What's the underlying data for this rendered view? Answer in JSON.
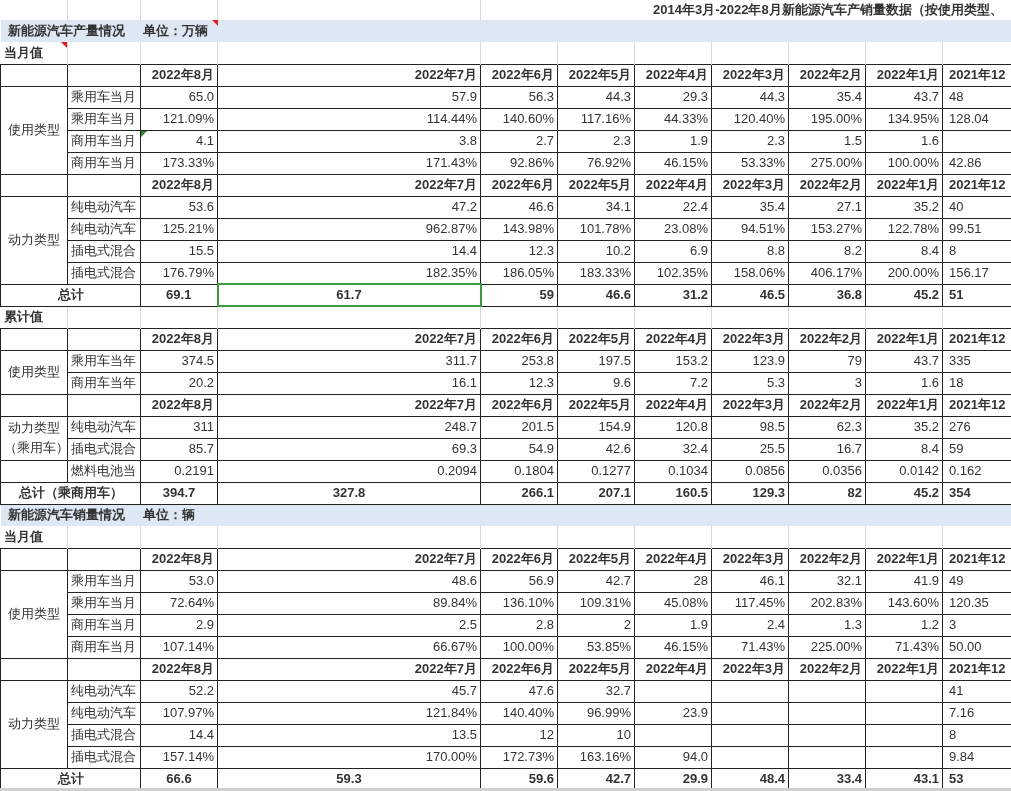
{
  "title": "2014年3月-2022年8月新能源汽车产销量数据（按使用类型、",
  "sections": [
    {
      "kind": "band",
      "title": "新能源汽车产量情况",
      "unit": "单位：万辆",
      "note": true
    },
    {
      "kind": "label",
      "text": "当月值",
      "note": true
    },
    {
      "kind": "block",
      "header": [
        "2022年8月",
        "2022年7月",
        "2022年6月",
        "2022年5月",
        "2022年4月",
        "2022年3月",
        "2022年2月",
        "2022年1月",
        "2021年12"
      ],
      "groups": [
        {
          "label": "使用类型",
          "rows": [
            {
              "label": "乘用车当月",
              "cells": [
                "65.0",
                "57.9",
                "56.3",
                "44.3",
                "29.3",
                "44.3",
                "35.4",
                "43.7",
                "48"
              ]
            },
            {
              "label": "乘用车当月",
              "cells": [
                "121.09%",
                "114.44%",
                "140.60%",
                "117.16%",
                "44.33%",
                "120.40%",
                "195.00%",
                "134.95%",
                "128.04"
              ]
            },
            {
              "label": "商用车当月",
              "warning": true,
              "cells": [
                "4.1",
                "3.8",
                "2.7",
                "2.3",
                "1.9",
                "2.3",
                "1.5",
                "1.6",
                null
              ]
            },
            {
              "label": "商用车当月",
              "cells": [
                "173.33%",
                "171.43%",
                "92.86%",
                "76.92%",
                "46.15%",
                "53.33%",
                "275.00%",
                "100.00%",
                "42.86"
              ]
            }
          ]
        }
      ]
    },
    {
      "kind": "block",
      "header": [
        "2022年8月",
        "2022年7月",
        "2022年6月",
        "2022年5月",
        "2022年4月",
        "2022年3月",
        "2022年2月",
        "2022年1月",
        "2021年12"
      ],
      "groups": [
        {
          "label": "动力类型",
          "rows": [
            {
              "label": "纯电动汽车",
              "cells": [
                "53.6",
                "47.2",
                "46.6",
                "34.1",
                "22.4",
                "35.4",
                "27.1",
                "35.2",
                "40"
              ]
            },
            {
              "label": "纯电动汽车",
              "cells": [
                "125.21%",
                "962.87%",
                "143.98%",
                "101.78%",
                "23.08%",
                "94.51%",
                "153.27%",
                "122.78%",
                "99.51"
              ]
            },
            {
              "label": "插电式混合",
              "cells": [
                "15.5",
                "14.4",
                "12.3",
                "10.2",
                "6.9",
                "8.8",
                "8.2",
                "8.4",
                "8"
              ]
            },
            {
              "label": "插电式混合",
              "cells": [
                "176.79%",
                "182.35%",
                "186.05%",
                "183.33%",
                "102.35%",
                "158.06%",
                "406.17%",
                "200.00%",
                "156.17"
              ]
            }
          ]
        }
      ]
    },
    {
      "kind": "total",
      "label": "总计",
      "cells": [
        {
          "value": "69.1",
          "selected": false
        },
        {
          "value": "61.7",
          "selected": true
        },
        {
          "value": "59",
          "selected": false
        },
        {
          "value": "46.6",
          "selected": false
        },
        {
          "value": "31.2",
          "selected": false
        },
        {
          "value": "46.5",
          "selected": false
        },
        {
          "value": "36.8",
          "selected": false
        },
        {
          "value": "45.2",
          "selected": false
        },
        {
          "value": "51",
          "selected": false
        }
      ]
    },
    {
      "kind": "label",
      "text": "累计值",
      "note": false
    },
    {
      "kind": "block",
      "header": [
        "2022年8月",
        "2022年7月",
        "2022年6月",
        "2022年5月",
        "2022年4月",
        "2022年3月",
        "2022年2月",
        "2022年1月",
        "2021年12"
      ],
      "groups": [
        {
          "label": "使用类型",
          "rows": [
            {
              "label": "乘用车当年",
              "cells": [
                "374.5",
                "311.7",
                "253.8",
                "197.5",
                "153.2",
                "123.9",
                "79",
                "43.7",
                "335"
              ]
            },
            {
              "label": "商用车当年",
              "cells": [
                "20.2",
                "16.1",
                "12.3",
                "9.6",
                "7.2",
                "5.3",
                "3",
                "1.6",
                "18"
              ]
            }
          ]
        }
      ]
    },
    {
      "kind": "block",
      "header": [
        "2022年8月",
        "2022年7月",
        "2022年6月",
        "2022年5月",
        "2022年4月",
        "2022年3月",
        "2022年2月",
        "2022年1月",
        "2021年12"
      ],
      "groups": [
        {
          "label": "动力类型",
          "label_2": "（乘用车）",
          "rows": [
            {
              "label": "纯电动汽车",
              "cells": [
                "311",
                "248.7",
                "201.5",
                "154.9",
                "120.8",
                "98.5",
                "62.3",
                "35.2",
                "276"
              ]
            },
            {
              "label": "插电式混合",
              "cells": [
                "85.7",
                "69.3",
                "54.9",
                "42.6",
                "32.4",
                "25.5",
                "16.7",
                "8.4",
                "59"
              ]
            }
          ]
        },
        {
          "rows": [
            {
              "label": "燃料电池当",
              "cells": [
                "0.2191",
                "0.2094",
                "0.1804",
                "0.1277",
                "0.1034",
                "0.0856",
                "0.0356",
                "0.0142",
                "0.162"
              ]
            }
          ]
        }
      ]
    },
    {
      "kind": "total",
      "label": "总计（乘商用车）",
      "cells": [
        {
          "value": "394.7",
          "selected": false
        },
        {
          "value": "327.8",
          "selected": false
        },
        {
          "value": "266.1",
          "selected": false
        },
        {
          "value": "207.1",
          "selected": false
        },
        {
          "value": "160.5",
          "selected": false
        },
        {
          "value": "129.3",
          "selected": false
        },
        {
          "value": "82",
          "selected": false
        },
        {
          "value": "45.2",
          "selected": false
        },
        {
          "value": "354",
          "selected": false
        }
      ]
    },
    {
      "kind": "band",
      "title": "新能源汽车销量情况",
      "unit": "单位：辆",
      "note": false
    },
    {
      "kind": "label",
      "text": "当月值",
      "note": false
    },
    {
      "kind": "block",
      "header": [
        "2022年8月",
        "2022年7月",
        "2022年6月",
        "2022年5月",
        "2022年4月",
        "2022年3月",
        "2022年2月",
        "2022年1月",
        "2021年12"
      ],
      "groups": [
        {
          "label": "使用类型",
          "rows": [
            {
              "label": "乘用车当月",
              "cells": [
                "53.0",
                "48.6",
                "56.9",
                "42.7",
                "28",
                "46.1",
                "32.1",
                "41.9",
                "49"
              ]
            },
            {
              "label": "乘用车当月",
              "cells": [
                "72.64%",
                "89.84%",
                "136.10%",
                "109.31%",
                "45.08%",
                "117.45%",
                "202.83%",
                "143.60%",
                "120.35"
              ]
            },
            {
              "label": "商用车当月",
              "cells": [
                "2.9",
                "2.5",
                "2.8",
                "2",
                "1.9",
                "2.4",
                "1.3",
                "1.2",
                "3"
              ]
            },
            {
              "label": "商用车当月",
              "cells": [
                "107.14%",
                "66.67%",
                "100.00%",
                "53.85%",
                "46.15%",
                "71.43%",
                "225.00%",
                "71.43%",
                "50.00"
              ]
            }
          ]
        }
      ]
    },
    {
      "kind": "block",
      "header": [
        "2022年8月",
        "2022年7月",
        "2022年6月",
        "2022年5月",
        "2022年4月",
        "2022年3月",
        "2022年2月",
        "2022年1月",
        "2021年12"
      ],
      "groups": [
        {
          "label": "动力类型",
          "rows": [
            {
              "label": "纯电动汽车",
              "cells": [
                "52.2",
                "45.7",
                "47.6",
                "32.7",
                null,
                null,
                null,
                null,
                "41"
              ]
            },
            {
              "label": "纯电动汽车",
              "cells": [
                "107.97%",
                "121.84%",
                "140.40%",
                "96.99%",
                "23.9",
                null,
                null,
                null,
                "7.16"
              ]
            },
            {
              "label": "插电式混合",
              "cells": [
                "14.4",
                "13.5",
                "12",
                "10",
                null,
                null,
                null,
                null,
                "8"
              ]
            },
            {
              "label": "插电式混合",
              "cells": [
                "157.14%",
                "170.00%",
                "172.73%",
                "163.16%",
                "94.0",
                null,
                null,
                null,
                "9.84"
              ]
            }
          ]
        }
      ]
    },
    {
      "kind": "total",
      "label": "总计",
      "cells": [
        {
          "value": "66.6",
          "selected": false
        },
        {
          "value": "59.3",
          "selected": false
        },
        {
          "value": "59.6",
          "selected": false
        },
        {
          "value": "42.7",
          "selected": false
        },
        {
          "value": "29.9",
          "selected": false
        },
        {
          "value": "48.4",
          "selected": false
        },
        {
          "value": "33.4",
          "selected": false
        },
        {
          "value": "43.1",
          "selected": false
        },
        {
          "value": "53",
          "selected": false
        }
      ]
    }
  ]
}
